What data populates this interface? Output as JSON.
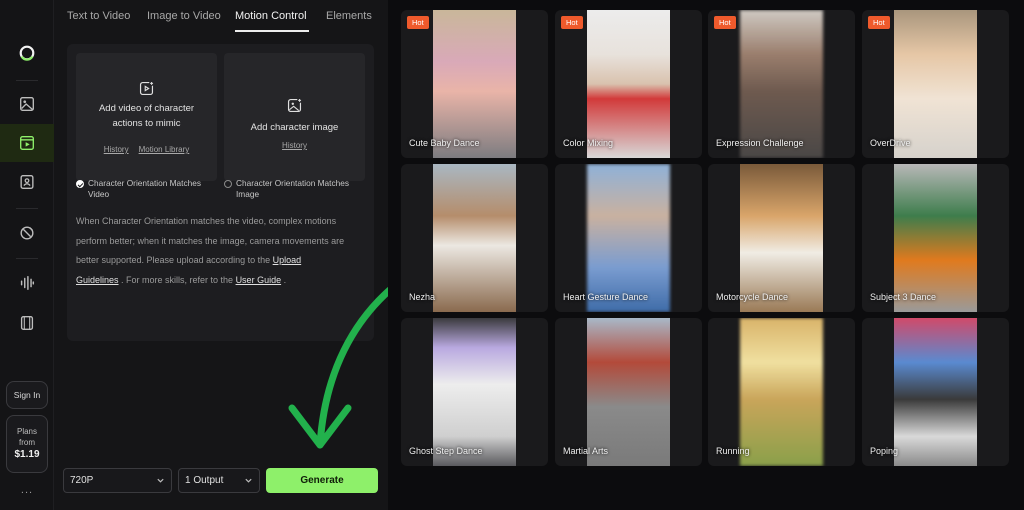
{
  "rail": {
    "sign_in": "Sign In",
    "plans_label": "Plans",
    "plans_from": "from",
    "plans_price": "$1.19",
    "more": "..."
  },
  "tabs": [
    {
      "label": "Text to Video"
    },
    {
      "label": "Image to Video"
    },
    {
      "label": "Motion Control"
    },
    {
      "label": "Elements"
    }
  ],
  "upload_video": {
    "title_line1": "Add video of character",
    "title_line2": "actions to mimic",
    "link_history": "History",
    "link_library": "Motion Library"
  },
  "upload_image": {
    "title": "Add character image",
    "link_history": "History"
  },
  "orientation": {
    "video_line1": "Character Orientation Matches",
    "video_line2": "Video",
    "image_line1": "Character Orientation Matches",
    "image_line2": "Image"
  },
  "note": {
    "text1": "When Character Orientation matches the video, complex motions perform better; when it matches the image, camera movements are better supported. Please upload according to the ",
    "link1_a": "Upload",
    "link1_b": "Guidelines",
    "text2": " . For more skills, refer to the ",
    "link2": "User Guide",
    "text3": " ."
  },
  "footer": {
    "resolution": "720P",
    "outputs": "1 Output",
    "generate": "Generate"
  },
  "gallery": {
    "hot_label": "Hot",
    "items": [
      {
        "caption": "Cute Baby Dance",
        "hot": true
      },
      {
        "caption": "Color Mixing",
        "hot": true
      },
      {
        "caption": "Expression Challenge",
        "hot": true
      },
      {
        "caption": "OverDrive",
        "hot": true
      },
      {
        "caption": "Nezha",
        "hot": false
      },
      {
        "caption": "Heart Gesture Dance",
        "hot": false
      },
      {
        "caption": "Motorcycle Dance",
        "hot": false
      },
      {
        "caption": "Subject 3 Dance",
        "hot": false
      },
      {
        "caption": "Ghost Step Dance",
        "hot": false
      },
      {
        "caption": "Martial Arts",
        "hot": false
      },
      {
        "caption": "Running",
        "hot": false
      },
      {
        "caption": "Poping",
        "hot": false
      }
    ]
  },
  "colors": {
    "accent": "#8ef06a",
    "hot_badge": "#ef5a2c",
    "annotation_arrow": "#22b14c"
  }
}
